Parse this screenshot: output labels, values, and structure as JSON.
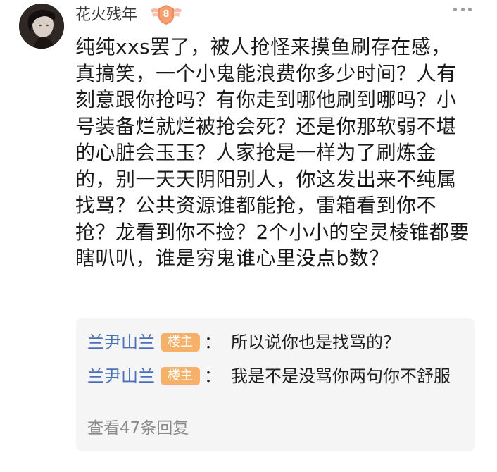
{
  "post": {
    "username": "花火残年",
    "level": "8",
    "body": "纯纯xxs罢了，被人抢怪来摸鱼刷存在感，真搞笑，一个小鬼能浪费你多少时间？人有刻意跟你抢吗？有你走到哪他刷到哪吗？小号装备烂就烂被抢会死？还是你那软弱不堪的心脏会玉玉？人家抢是一样为了刷炼金的，别一天天阴阳别人，你这发出来不纯属找骂？公共资源谁都能抢，雷箱看到你不抢？龙看到你不捡？2个小小的空灵棱锥都要瞎叭叭，谁是穷鬼谁心里没点b数？"
  },
  "replies": [
    {
      "author": "兰尹山兰",
      "badge": "楼主",
      "colon": "：",
      "text": "所以说你也是找骂的？"
    },
    {
      "author": "兰尹山兰",
      "badge": "楼主",
      "colon": "：",
      "text": "我是不是没骂你两句你不舒服"
    }
  ],
  "view_replies_label": "查看47条回复",
  "icons": {
    "avatar": "dark-portrait-avatar",
    "level_badge": "winged-shield-level-icon",
    "more": "more-options-icon"
  },
  "colors": {
    "badge_orange": "#f5b16a",
    "author_blue": "#4a71b8",
    "reply_bg": "#f5f5f5"
  }
}
